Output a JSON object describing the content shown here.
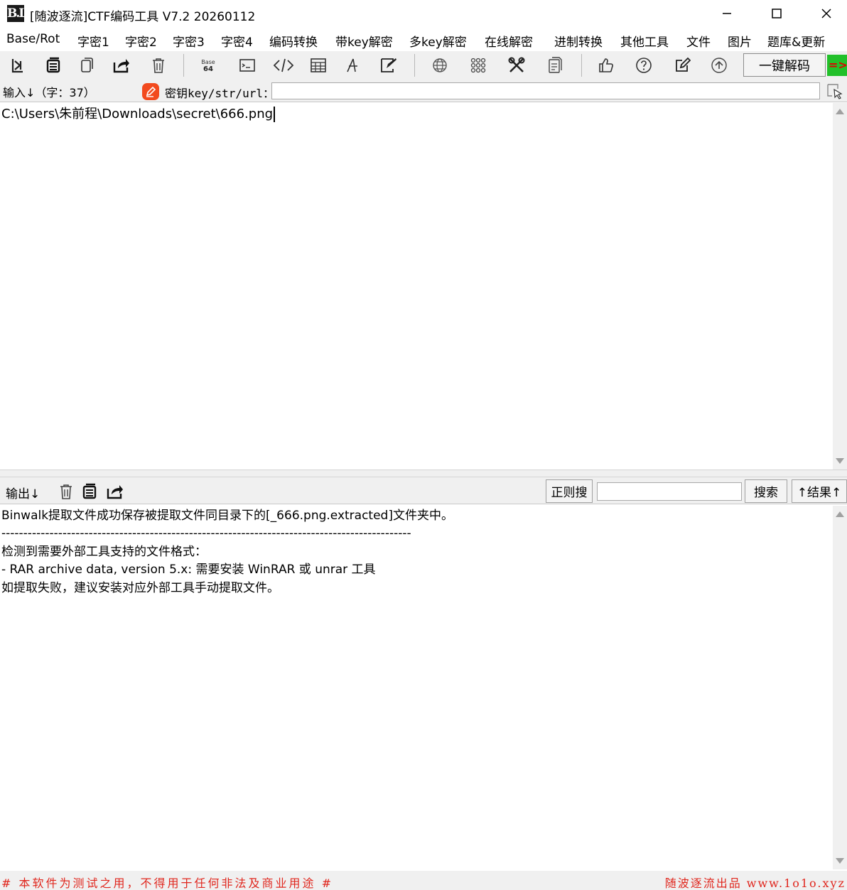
{
  "window": {
    "title": "[随波逐流]CTF编码工具 V7.2  20260112",
    "logo_text": "B.L"
  },
  "menu": [
    "Base/Rot",
    "字密1",
    "字密2",
    "字密3",
    "字密4",
    "编码转换",
    "带key解密",
    "多key解密",
    "在线解密",
    "进制转换",
    "其他工具",
    "文件",
    "图片",
    "题库&更新"
  ],
  "toolbar": {
    "icons": [
      "import-icon",
      "copy-stack-icon",
      "copy-icon",
      "share-icon",
      "trash-icon",
      "base64-icon",
      "terminal-icon",
      "code-icon",
      "calculator-icon",
      "font-icon",
      "edit-frame-icon",
      "globe-icon",
      "grid-icon",
      "tools-icon",
      "document-icon",
      "thumbs-up-icon",
      "help-icon",
      "note-edit-icon",
      "upload-icon"
    ],
    "base64_text": "Base\n64",
    "decode_all_label": "一键解码",
    "decode_arrow": "=>"
  },
  "input": {
    "label": "输入↓（字：37）",
    "key_label": "密钥key/str/url：",
    "key_value": "",
    "text": "C:\\Users\\朱前程\\Downloads\\secret\\666.png"
  },
  "output": {
    "label": "输出↓",
    "regex_search_label": "正则搜",
    "regex_value": "",
    "search_label": "搜索",
    "result_label": "↑结果↑",
    "lines": [
      "Binwalk提取文件成功保存被提取文件同目录下的[_666.png.extracted]文件夹中。",
      "----------------------------------------------------------------------------------------------",
      "检测到需要外部工具支持的文件格式：",
      "- RAR archive data, version 5.x: 需要安装 WinRAR 或 unrar 工具",
      "如提取失败，建议安装对应外部工具手动提取文件。"
    ]
  },
  "status": {
    "left": "# 本软件为测试之用，不得用于任何非法及商业用途 #",
    "right": "随波逐流出品 www.1o1o.xyz"
  },
  "colors": {
    "status_text": "#e0261d",
    "decode_arrow_bg": "#22c02a",
    "key_icon": "#f24a1e"
  }
}
